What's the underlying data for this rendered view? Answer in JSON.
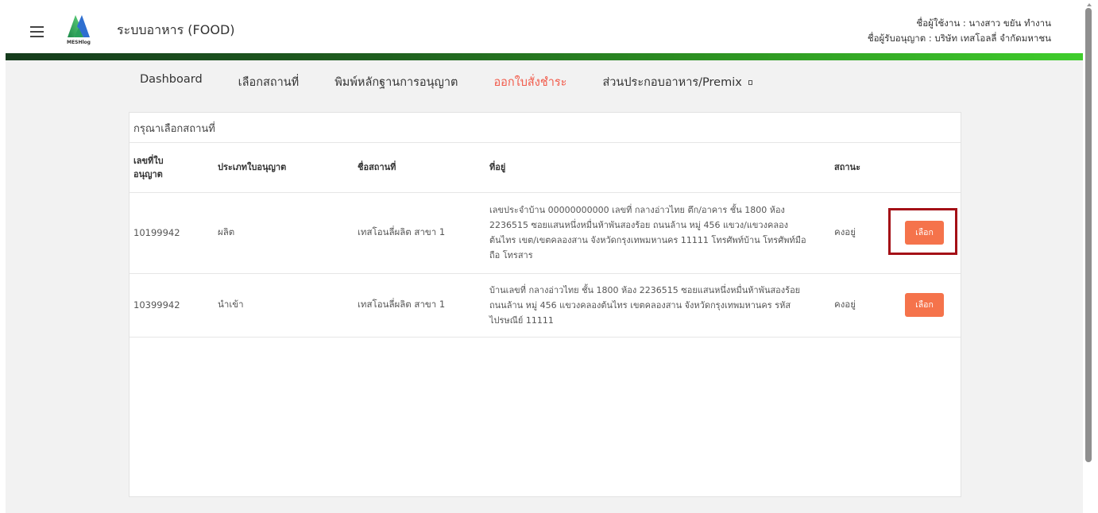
{
  "header": {
    "app_title": "ระบบอาหาร (FOOD)",
    "logo_text": "MESHlog",
    "user_line": "ชื่อผู้ใช้งาน : นางสาว ขยัน ทำงาน",
    "licensee_line": "ชื่อผู้รับอนุญาต : บริษัท เทสโอลลี่ จำกัดมหาชน"
  },
  "nav": {
    "items": [
      "Dashboard",
      "เลือกสถานที่",
      "พิมพ์หลักฐานการอนุญาต",
      "ออกใบสั่งชำระ",
      "ส่วนประกอบอาหาร/Premix"
    ],
    "active_index": 3,
    "active_color": "#f25a4a"
  },
  "card": {
    "title": "กรุณาเลือกสถานที่",
    "columns": [
      "เลขที่ใบอนุญาต",
      "ประเภทใบอนุญาต",
      "ชื่อสถานที่",
      "ที่อยู่",
      "สถานะ"
    ],
    "rows": [
      {
        "license_no": "10199942",
        "type": "ผลิต",
        "place": "เทสโอนลี่ผลิต สาขา 1",
        "address": "เลขประจำบ้าน 00000000000 เลขที่ กลางอ่าวไทย ตึก/อาคาร ชั้น 1800 ห้อง 2236515 ซอยแสนหนึ่งหมื่นห้าพันสองร้อย ถนนล้าน หมู่ 456 แขวง/แขวงคลองต้นไทร เขต/เขตคลองสาน จังหวัดกรุงเทพมหานคร 11111 โทรศัพท์บ้าน โทรศัพท์มือถือ โทรสาร",
        "status": "คงอยู่",
        "button": "เลือก"
      },
      {
        "license_no": "10399942",
        "type": "นำเข้า",
        "place": "เทสโอนลี่ผลิต สาขา 1",
        "address": "บ้านเลขที่ กลางอ่าวไทย ชั้น 1800 ห้อง 2236515 ซอยแสนหนึ่งหมื่นห้าพันสองร้อย ถนนล้าน หมู่ 456 แขวงคลองต้นไทร เขตคลองสาน จังหวัดกรุงเทพมหานคร รหัสไปรษณีย์ 11111",
        "status": "คงอยู่",
        "button": "เลือก"
      }
    ]
  },
  "colors": {
    "button": "#f5734b",
    "highlight": "#a41016",
    "bar_start": "#153b1c",
    "bar_end": "#3fcd2c"
  }
}
